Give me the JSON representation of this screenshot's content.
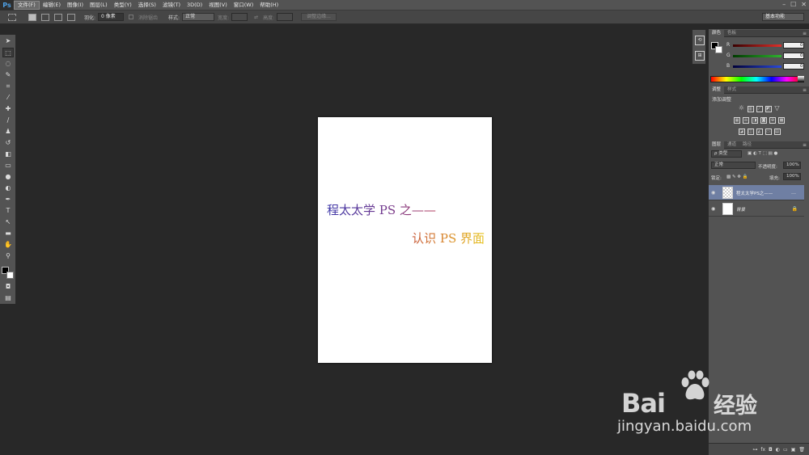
{
  "app": {
    "logo": "Ps"
  },
  "menu": {
    "items": [
      "文件(F)",
      "编辑(E)",
      "图像(I)",
      "图层(L)",
      "类型(Y)",
      "选择(S)",
      "滤镜(T)",
      "3D(D)",
      "视图(V)",
      "窗口(W)",
      "帮助(H)"
    ],
    "window_controls": [
      "–",
      "☐",
      "✕"
    ]
  },
  "options": {
    "feather_label": "羽化:",
    "feather_value": "0 像素",
    "antialias_label": "消除锯齿",
    "style_label": "样式:",
    "style_value": "正常",
    "width_label": "宽度:",
    "height_label": "高度:",
    "refine_edge_button": "调整边缘...",
    "workspace": "基本功能"
  },
  "document": {
    "line1": "程太太学 PS 之——",
    "line2": "认识 PS 界面"
  },
  "panels": {
    "color": {
      "tabs": [
        "颜色",
        "色板"
      ],
      "sliders": [
        {
          "label": "R",
          "value": "0",
          "color": "#e0302a"
        },
        {
          "label": "G",
          "value": "0",
          "color": "#2fb32f"
        },
        {
          "label": "B",
          "value": "0",
          "color": "#2a49d8"
        }
      ]
    },
    "adjustments": {
      "tabs": [
        "调整",
        "样式"
      ],
      "title": "添加调整"
    },
    "layers": {
      "tabs": [
        "图层",
        "通道",
        "路径"
      ],
      "filter_label": "ρ 类型",
      "blend_mode": "正常",
      "opacity_label": "不透明度:",
      "opacity_value": "100%",
      "lock_label": "锁定:",
      "fill_label": "填充:",
      "fill_value": "100%",
      "items": [
        {
          "name": "程太太学PS之——",
          "fx": "…",
          "selected": true
        },
        {
          "name": "背景",
          "selected": false
        }
      ]
    }
  },
  "watermark": {
    "brand": "Bai",
    "brand_cn": "经验",
    "url": "jingyan.baidu.com"
  }
}
